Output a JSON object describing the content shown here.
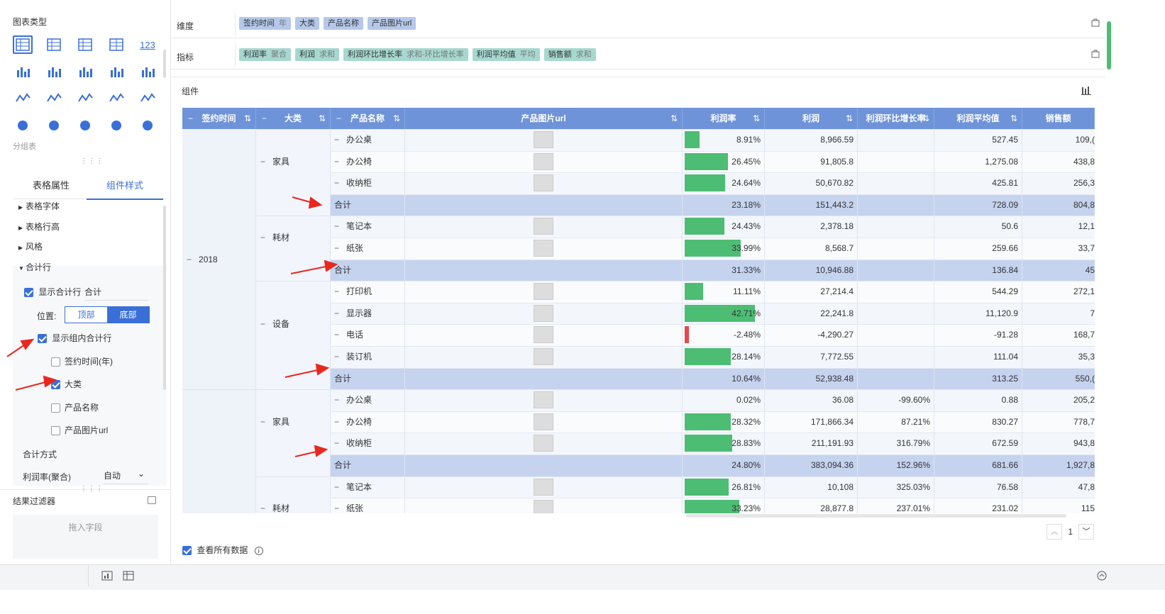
{
  "left": {
    "chart_type_title": "图表类型",
    "subgroup_label": "分组表",
    "tabs": [
      "表格属性",
      "组件样式"
    ],
    "tree": [
      "表格字体",
      "表格行高",
      "风格",
      "合计行"
    ],
    "show_total_label": "显示合计行",
    "show_total_value": "合计",
    "position_label": "位置:",
    "position_options": [
      "顶部",
      "底部"
    ],
    "show_group_total_label": "显示组内合计行",
    "group_fields": [
      "签约时间(年)",
      "大类",
      "产品名称",
      "产品图片url"
    ],
    "total_method_label": "合计方式",
    "metric_label": "利润率(聚合)",
    "metric_value": "自动",
    "result_filter_label": "结果过滤器",
    "drag_field_placeholder": "拖入字段",
    "icon_123": "123"
  },
  "dims": {
    "label": "维度",
    "pills": [
      {
        "name": "签约时间",
        "agg": "年"
      },
      {
        "name": "大类",
        "agg": ""
      },
      {
        "name": "产品名称",
        "agg": ""
      },
      {
        "name": "产品图片url",
        "agg": ""
      }
    ]
  },
  "measures": {
    "label": "指标",
    "pills": [
      {
        "name": "利润率",
        "agg": "聚合"
      },
      {
        "name": "利润",
        "agg": "求和"
      },
      {
        "name": "利润环比增长率",
        "agg": "求和-环比增长率"
      },
      {
        "name": "利润平均值",
        "agg": "平均"
      },
      {
        "name": "销售额",
        "agg": "求和"
      }
    ]
  },
  "component": {
    "title": "组件",
    "headers": [
      "签约时间",
      "大类",
      "产品名称",
      "产品图片url",
      "利润率",
      "利润",
      "利润环比增长率",
      "利润平均值",
      "销售额"
    ],
    "year": "2018",
    "groups": [
      "家具",
      "耗材",
      "设备",
      "家具",
      "耗材"
    ],
    "total_label": "合计",
    "rows": [
      {
        "product": "办公桌",
        "rate": "8.91%",
        "rate_v": 8.91,
        "profit": "8,966.59",
        "growth": "",
        "avg": "527.45",
        "sales": "109,("
      },
      {
        "product": "办公椅",
        "rate": "26.45%",
        "rate_v": 26.45,
        "profit": "91,805.8",
        "growth": "",
        "avg": "1,275.08",
        "sales": "438,8"
      },
      {
        "product": "收纳柜",
        "rate": "24.64%",
        "rate_v": 24.64,
        "profit": "50,670.82",
        "growth": "",
        "avg": "425.81",
        "sales": "256,3"
      },
      {
        "total": true,
        "rate": "23.18%",
        "profit": "151,443.2",
        "growth": "",
        "avg": "728.09",
        "sales": "804,8"
      },
      {
        "product": "笔记本",
        "rate": "24.43%",
        "rate_v": 24.43,
        "profit": "2,378.18",
        "growth": "",
        "avg": "50.6",
        "sales": "12,1"
      },
      {
        "product": "纸张",
        "rate": "33.99%",
        "rate_v": 33.99,
        "profit": "8,568.7",
        "growth": "",
        "avg": "259.66",
        "sales": "33,7"
      },
      {
        "total": true,
        "rate": "31.33%",
        "profit": "10,946.88",
        "growth": "",
        "avg": "136.84",
        "sales": "45"
      },
      {
        "product": "打印机",
        "rate": "11.11%",
        "rate_v": 11.11,
        "profit": "27,214.4",
        "growth": "",
        "avg": "544.29",
        "sales": "272,1"
      },
      {
        "product": "显示器",
        "rate": "42.71%",
        "rate_v": 42.71,
        "profit": "22,241.8",
        "growth": "",
        "avg": "11,120.9",
        "sales": "7"
      },
      {
        "product": "电话",
        "rate": "-2.48%",
        "rate_v": -2.48,
        "profit": "-4,290.27",
        "growth": "",
        "avg": "-91.28",
        "sales": "168,7"
      },
      {
        "product": "装订机",
        "rate": "28.14%",
        "rate_v": 28.14,
        "profit": "7,772.55",
        "growth": "",
        "avg": "111.04",
        "sales": "35,3"
      },
      {
        "total": true,
        "rate": "10.64%",
        "profit": "52,938.48",
        "growth": "",
        "avg": "313.25",
        "sales": "550,("
      },
      {
        "product": "办公桌",
        "rate": "0.02%",
        "rate_v": 0.02,
        "profit": "36.08",
        "growth": "-99.60%",
        "avg": "0.88",
        "sales": "205,2"
      },
      {
        "product": "办公椅",
        "rate": "28.32%",
        "rate_v": 28.32,
        "profit": "171,866.34",
        "growth": "87.21%",
        "avg": "830.27",
        "sales": "778,7"
      },
      {
        "product": "收纳柜",
        "rate": "28.83%",
        "rate_v": 28.83,
        "profit": "211,191.93",
        "growth": "316.79%",
        "avg": "672.59",
        "sales": "943,8"
      },
      {
        "total": true,
        "rate": "24.80%",
        "profit": "383,094.36",
        "growth": "152.96%",
        "avg": "681.66",
        "sales": "1,927,8"
      },
      {
        "product": "笔记本",
        "rate": "26.81%",
        "rate_v": 26.81,
        "profit": "10,108",
        "growth": "325.03%",
        "avg": "76.58",
        "sales": "47,8"
      },
      {
        "product": "纸张",
        "rate": "33.23%",
        "rate_v": 33.23,
        "profit": "28,877.8",
        "growth": "237.01%",
        "avg": "231.02",
        "sales": "115"
      }
    ],
    "page": "1",
    "view_all_label": "查看所有数据"
  },
  "colors": {
    "accent": "#3a6fd8",
    "header": "#6f93d8",
    "total_row": "#c5d3ef",
    "bar_positive": "#4dbd74",
    "bar_negative": "#e54a4a"
  }
}
